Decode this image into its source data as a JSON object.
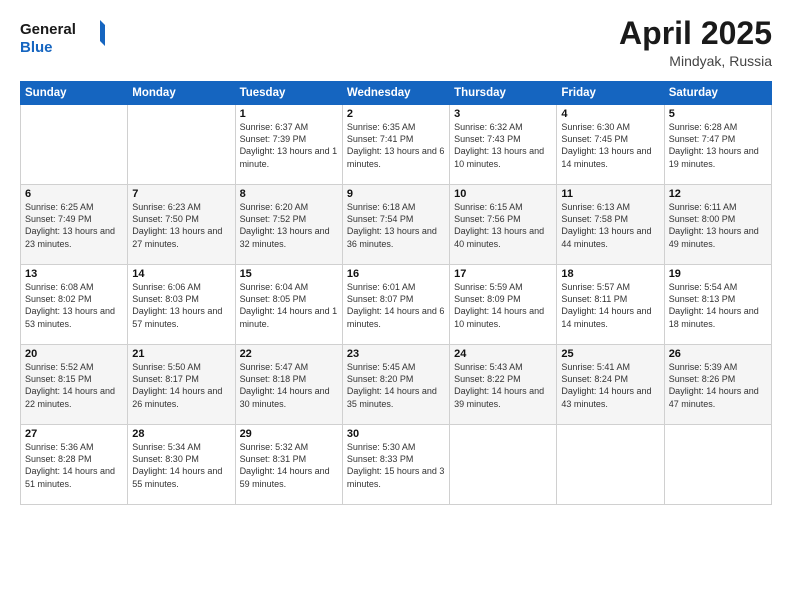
{
  "header": {
    "logo_general": "General",
    "logo_blue": "Blue",
    "month_title": "April 2025",
    "location": "Mindyak, Russia"
  },
  "weekdays": [
    "Sunday",
    "Monday",
    "Tuesday",
    "Wednesday",
    "Thursday",
    "Friday",
    "Saturday"
  ],
  "rows": [
    [
      {
        "day": "",
        "info": ""
      },
      {
        "day": "",
        "info": ""
      },
      {
        "day": "1",
        "info": "Sunrise: 6:37 AM\nSunset: 7:39 PM\nDaylight: 13 hours and 1 minute."
      },
      {
        "day": "2",
        "info": "Sunrise: 6:35 AM\nSunset: 7:41 PM\nDaylight: 13 hours and 6 minutes."
      },
      {
        "day": "3",
        "info": "Sunrise: 6:32 AM\nSunset: 7:43 PM\nDaylight: 13 hours and 10 minutes."
      },
      {
        "day": "4",
        "info": "Sunrise: 6:30 AM\nSunset: 7:45 PM\nDaylight: 13 hours and 14 minutes."
      },
      {
        "day": "5",
        "info": "Sunrise: 6:28 AM\nSunset: 7:47 PM\nDaylight: 13 hours and 19 minutes."
      }
    ],
    [
      {
        "day": "6",
        "info": "Sunrise: 6:25 AM\nSunset: 7:49 PM\nDaylight: 13 hours and 23 minutes."
      },
      {
        "day": "7",
        "info": "Sunrise: 6:23 AM\nSunset: 7:50 PM\nDaylight: 13 hours and 27 minutes."
      },
      {
        "day": "8",
        "info": "Sunrise: 6:20 AM\nSunset: 7:52 PM\nDaylight: 13 hours and 32 minutes."
      },
      {
        "day": "9",
        "info": "Sunrise: 6:18 AM\nSunset: 7:54 PM\nDaylight: 13 hours and 36 minutes."
      },
      {
        "day": "10",
        "info": "Sunrise: 6:15 AM\nSunset: 7:56 PM\nDaylight: 13 hours and 40 minutes."
      },
      {
        "day": "11",
        "info": "Sunrise: 6:13 AM\nSunset: 7:58 PM\nDaylight: 13 hours and 44 minutes."
      },
      {
        "day": "12",
        "info": "Sunrise: 6:11 AM\nSunset: 8:00 PM\nDaylight: 13 hours and 49 minutes."
      }
    ],
    [
      {
        "day": "13",
        "info": "Sunrise: 6:08 AM\nSunset: 8:02 PM\nDaylight: 13 hours and 53 minutes."
      },
      {
        "day": "14",
        "info": "Sunrise: 6:06 AM\nSunset: 8:03 PM\nDaylight: 13 hours and 57 minutes."
      },
      {
        "day": "15",
        "info": "Sunrise: 6:04 AM\nSunset: 8:05 PM\nDaylight: 14 hours and 1 minute."
      },
      {
        "day": "16",
        "info": "Sunrise: 6:01 AM\nSunset: 8:07 PM\nDaylight: 14 hours and 6 minutes."
      },
      {
        "day": "17",
        "info": "Sunrise: 5:59 AM\nSunset: 8:09 PM\nDaylight: 14 hours and 10 minutes."
      },
      {
        "day": "18",
        "info": "Sunrise: 5:57 AM\nSunset: 8:11 PM\nDaylight: 14 hours and 14 minutes."
      },
      {
        "day": "19",
        "info": "Sunrise: 5:54 AM\nSunset: 8:13 PM\nDaylight: 14 hours and 18 minutes."
      }
    ],
    [
      {
        "day": "20",
        "info": "Sunrise: 5:52 AM\nSunset: 8:15 PM\nDaylight: 14 hours and 22 minutes."
      },
      {
        "day": "21",
        "info": "Sunrise: 5:50 AM\nSunset: 8:17 PM\nDaylight: 14 hours and 26 minutes."
      },
      {
        "day": "22",
        "info": "Sunrise: 5:47 AM\nSunset: 8:18 PM\nDaylight: 14 hours and 30 minutes."
      },
      {
        "day": "23",
        "info": "Sunrise: 5:45 AM\nSunset: 8:20 PM\nDaylight: 14 hours and 35 minutes."
      },
      {
        "day": "24",
        "info": "Sunrise: 5:43 AM\nSunset: 8:22 PM\nDaylight: 14 hours and 39 minutes."
      },
      {
        "day": "25",
        "info": "Sunrise: 5:41 AM\nSunset: 8:24 PM\nDaylight: 14 hours and 43 minutes."
      },
      {
        "day": "26",
        "info": "Sunrise: 5:39 AM\nSunset: 8:26 PM\nDaylight: 14 hours and 47 minutes."
      }
    ],
    [
      {
        "day": "27",
        "info": "Sunrise: 5:36 AM\nSunset: 8:28 PM\nDaylight: 14 hours and 51 minutes."
      },
      {
        "day": "28",
        "info": "Sunrise: 5:34 AM\nSunset: 8:30 PM\nDaylight: 14 hours and 55 minutes."
      },
      {
        "day": "29",
        "info": "Sunrise: 5:32 AM\nSunset: 8:31 PM\nDaylight: 14 hours and 59 minutes."
      },
      {
        "day": "30",
        "info": "Sunrise: 5:30 AM\nSunset: 8:33 PM\nDaylight: 15 hours and 3 minutes."
      },
      {
        "day": "",
        "info": ""
      },
      {
        "day": "",
        "info": ""
      },
      {
        "day": "",
        "info": ""
      }
    ]
  ]
}
